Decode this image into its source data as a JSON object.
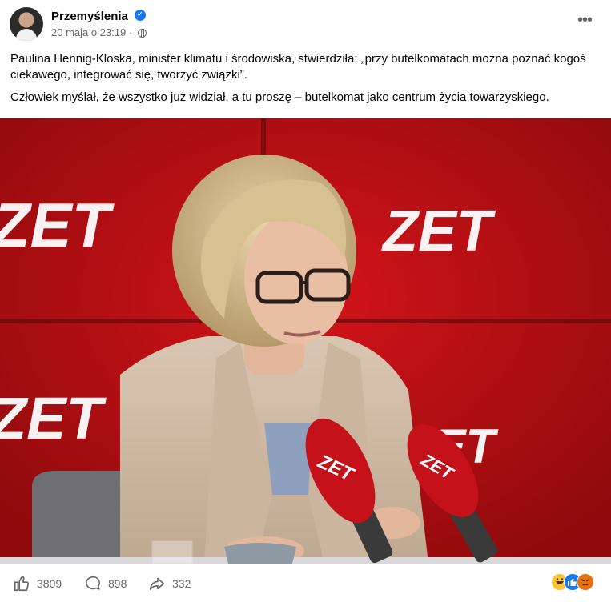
{
  "post": {
    "page_name": "Przemyślenia",
    "date": "20 maja o 23:19",
    "separator": "·",
    "more_label": "•••",
    "paragraph_1": "Paulina Hennig-Kloska, minister klimatu i środowiska, stwierdziła: „przy butelkomatach można poznać kogoś ciekawego, integrować się, tworzyć związki”.",
    "paragraph_2": "Człowiek myślał, że wszystko już widział, a tu proszę – butelkomat jako centrum życia towarzyskiego."
  },
  "photo": {
    "logo_text": "ZET",
    "background_color": "#b80d10"
  },
  "footer": {
    "likes_count": "3809",
    "comments_count": "898",
    "shares_count": "332",
    "reaction_icons": [
      "haha-icon",
      "like-icon",
      "angry-icon"
    ]
  },
  "colors": {
    "verified": "#1877f2",
    "meta_text": "#65676b"
  }
}
